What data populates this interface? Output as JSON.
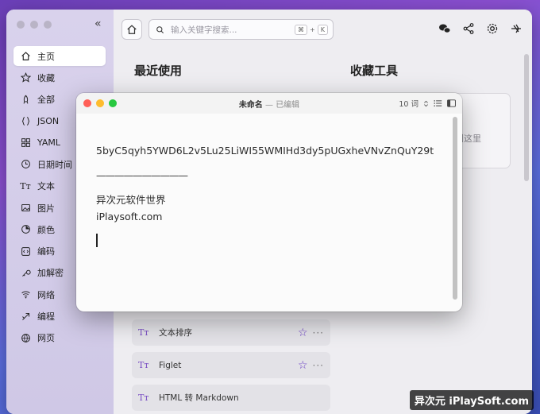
{
  "sidebar": {
    "collapse_icon": "«",
    "items": [
      {
        "label": "主页",
        "icon": "home-icon"
      },
      {
        "label": "收藏",
        "icon": "star-icon"
      },
      {
        "label": "全部",
        "icon": "rocket-icon"
      },
      {
        "label": "JSON",
        "icon": "braces-icon"
      },
      {
        "label": "YAML",
        "icon": "grid-icon"
      },
      {
        "label": "日期时间",
        "icon": "clock-icon"
      },
      {
        "label": "文本",
        "icon": "text-icon"
      },
      {
        "label": "图片",
        "icon": "image-icon"
      },
      {
        "label": "颜色",
        "icon": "palette-icon"
      },
      {
        "label": "编码",
        "icon": "code-icon"
      },
      {
        "label": "加解密",
        "icon": "lock-icon"
      },
      {
        "label": "网络",
        "icon": "wifi-icon"
      },
      {
        "label": "编程",
        "icon": "terminal-icon"
      },
      {
        "label": "网页",
        "icon": "globe-icon"
      }
    ]
  },
  "toolbar": {
    "search_placeholder": "输入关键字搜索...",
    "shortcut_key1": "⌘",
    "shortcut_plus": "+",
    "shortcut_key2": "K"
  },
  "main": {
    "recent_title": "最近使用",
    "favorites_title": "收藏工具",
    "favorites_hint": "到这里",
    "list": [
      {
        "label": "文本排序",
        "icon_text": "Tт"
      },
      {
        "label": "Figlet",
        "icon_text": "Tт"
      },
      {
        "label": "HTML 转 Markdown",
        "icon_text": "Tт"
      }
    ]
  },
  "note": {
    "title": "未命名",
    "separator": "—",
    "status": "已编辑",
    "word_count": "10 词",
    "lines": [
      "5byC5qyh5YWD6L2v5Lu25LiWI55WMIHd3dy5pUGxheVNvZnQuY29t",
      "——————————",
      "异次元软件世界",
      "iPlaysoft.com"
    ]
  },
  "watermark": "异次元 iPlaySoft.com",
  "colors": {
    "accent": "#6b3fc4",
    "close": "#ff5f57",
    "minimize": "#febc2e",
    "zoom": "#28c840"
  }
}
